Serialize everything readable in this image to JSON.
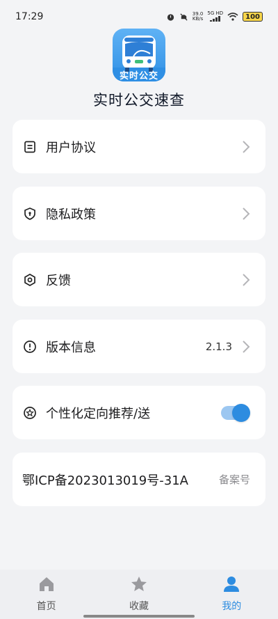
{
  "status_bar": {
    "time": "17:29",
    "net_speed_value": "39.0",
    "net_speed_unit": "KB/s",
    "network": "5G HD",
    "battery": "100"
  },
  "app": {
    "logo_text": "实时公交",
    "title": "实时公交速查"
  },
  "menu": {
    "user_agreement": "用户协议",
    "privacy_policy": "隐私政策",
    "feedback": "反馈",
    "version_label": "版本信息",
    "version_value": "2.1.3",
    "personalized_label": "个性化定向推荐/送",
    "personalized_enabled": true,
    "icp_number": "鄂ICP备2023013019号-31A",
    "icp_label": "备案号"
  },
  "tabs": [
    {
      "label": "首页",
      "icon": "home-icon"
    },
    {
      "label": "收藏",
      "icon": "star-icon"
    },
    {
      "label": "我的",
      "icon": "user-icon"
    }
  ],
  "colors": {
    "accent": "#2d8ce0",
    "background": "#f3f4f6",
    "card": "#ffffff"
  }
}
